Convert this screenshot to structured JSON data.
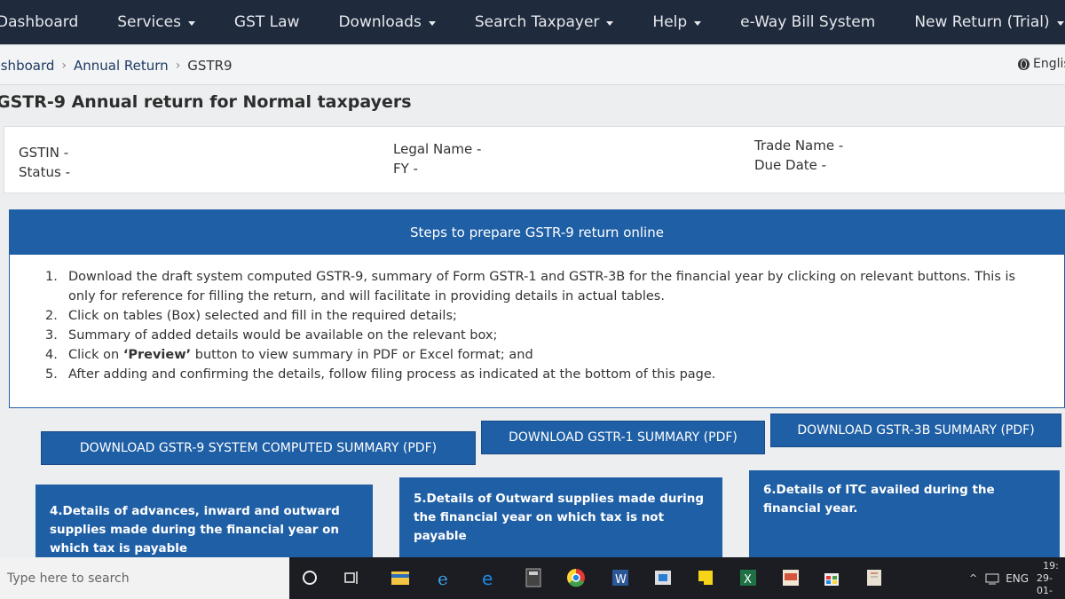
{
  "nav": {
    "items": [
      {
        "label": "Dashboard",
        "caret": false
      },
      {
        "label": "Services",
        "caret": true
      },
      {
        "label": "GST Law",
        "caret": false
      },
      {
        "label": "Downloads",
        "caret": true
      },
      {
        "label": "Search Taxpayer",
        "caret": true
      },
      {
        "label": "Help",
        "caret": true
      },
      {
        "label": "e-Way Bill System",
        "caret": false
      },
      {
        "label": "New Return (Trial)",
        "caret": true
      }
    ]
  },
  "breadcrumb": {
    "items": [
      "Dashboard",
      "Annual Return",
      "GSTR9"
    ],
    "language": "English"
  },
  "page": {
    "title": "GSTR-9 Annual return for Normal taxpayers"
  },
  "details": {
    "gstin": "GSTIN -",
    "status": "Status -",
    "legal_name": "Legal Name -",
    "fy": "FY -",
    "trade_name": "Trade Name -",
    "due_date": "Due Date -"
  },
  "steps": {
    "heading": "Steps to prepare GSTR-9 return online",
    "items": [
      {
        "num": "1.",
        "pre": "Download the draft system computed GSTR-9, summary of Form GSTR-1 and GSTR-3B for the financial year by clicking on relevant buttons. This is only for reference for filling the return, and will facilitate in providing details in actual tables.",
        "bold": "",
        "post": ""
      },
      {
        "num": "2.",
        "pre": "Click on tables (Box) selected and fill in the required details;",
        "bold": "",
        "post": ""
      },
      {
        "num": "3.",
        "pre": "Summary of added details would be available on the relevant box;",
        "bold": "",
        "post": ""
      },
      {
        "num": "4.",
        "pre": "Click on ",
        "bold": "‘Preview’",
        "post": " button to view summary in PDF or Excel format; and"
      },
      {
        "num": "5.",
        "pre": "After adding and confirming the details, follow filing process as indicated at the bottom of this page.",
        "bold": "",
        "post": ""
      }
    ]
  },
  "downloads": {
    "gstr9": "DOWNLOAD GSTR-9 SYSTEM COMPUTED SUMMARY (PDF)",
    "gstr1": "DOWNLOAD GSTR-1 SUMMARY (PDF)",
    "gstr3b": "DOWNLOAD GSTR-3B SUMMARY (PDF)"
  },
  "tiles": {
    "t4": "4.Details of advances, inward and outward supplies made during the financial year on which tax is payable",
    "t5": "5.Details of Outward supplies made during the financial year on which tax is not payable",
    "t6": "6.Details of ITC availed during the financial year."
  },
  "taskbar": {
    "search_placeholder": "Type here to search",
    "lang": "ENG",
    "time": "19:",
    "date": "29-01-"
  },
  "colors": {
    "nav_bg": "#1f2a3c",
    "primary": "#1f5fa5"
  }
}
